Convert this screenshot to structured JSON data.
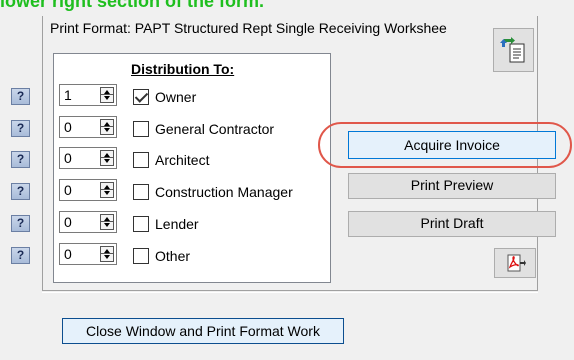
{
  "caption": "lower right section of the form.",
  "print_format": "Print Format: PAPT Structured Rept Single Receiving Workshee",
  "distribution": {
    "title": "Distribution To:",
    "rows": [
      {
        "help": "?",
        "count": "1",
        "label": "Owner",
        "checked": true
      },
      {
        "help": "?",
        "count": "0",
        "label": "General Contractor",
        "checked": false
      },
      {
        "help": "?",
        "count": "0",
        "label": "Architect",
        "checked": false
      },
      {
        "help": "?",
        "count": "0",
        "label": "Construction Manager",
        "checked": false
      },
      {
        "help": "?",
        "count": "0",
        "label": "Lender",
        "checked": false
      },
      {
        "help": "?",
        "count": "0",
        "label": "Other",
        "checked": false
      }
    ]
  },
  "buttons": {
    "acquire_invoice": "Acquire Invoice",
    "print_preview": "Print Preview",
    "print_draft": "Print Draft",
    "close": "Close Window and Print Format Work"
  },
  "icons": {
    "format_icon": "document-arrows-icon",
    "pdf_icon": "pdf-icon"
  },
  "colors": {
    "highlight": "#e0574a",
    "caption": "#1fbf1f",
    "accent_border": "#0078d7"
  }
}
